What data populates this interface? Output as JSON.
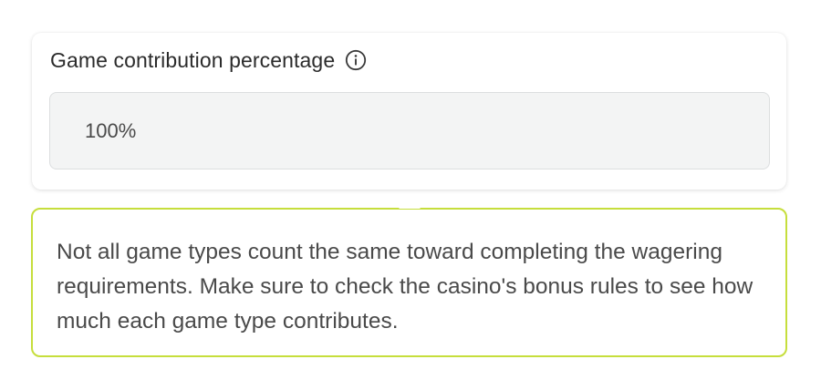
{
  "card": {
    "title": "Game contribution percentage",
    "info_icon": "info-circle-icon",
    "value": "100%"
  },
  "tooltip": {
    "text": "Not all game types count the same toward completing the wagering requirements. Make sure to check the casino's bonus rules to see how much each game type contributes."
  },
  "colors": {
    "tooltip_border": "#c6de3c",
    "value_box_bg": "#f3f4f4",
    "text": "#4a4a4a",
    "title": "#2b2b2b"
  }
}
